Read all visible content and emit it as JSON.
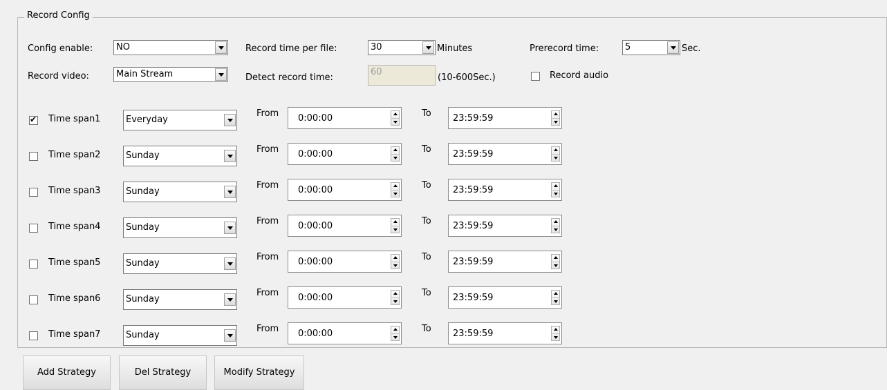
{
  "group_title": "Record Config",
  "config_enable": {
    "label": "Config enable:",
    "value": "NO"
  },
  "record_time_per_file": {
    "label": "Record time per file:",
    "value": "30",
    "unit": "Minutes"
  },
  "prerecord_time": {
    "label": "Prerecord time:",
    "value": "5",
    "unit": "Sec."
  },
  "record_video": {
    "label": "Record video:",
    "value": "Main Stream"
  },
  "detect_record_time": {
    "label": "Detect record time:",
    "value": "60",
    "hint": "(10-600Sec.)"
  },
  "record_audio": {
    "label": "Record audio",
    "checked": false
  },
  "time_spans": [
    {
      "label": "Time span1",
      "checked": true,
      "day": "Everyday",
      "from_label": "From",
      "from": "0:00:00",
      "to_label": "To",
      "to": "23:59:59"
    },
    {
      "label": "Time span2",
      "checked": false,
      "day": "Sunday",
      "from_label": "From",
      "from": "0:00:00",
      "to_label": "To",
      "to": "23:59:59"
    },
    {
      "label": "Time span3",
      "checked": false,
      "day": "Sunday",
      "from_label": "From",
      "from": "0:00:00",
      "to_label": "To",
      "to": "23:59:59"
    },
    {
      "label": "Time span4",
      "checked": false,
      "day": "Sunday",
      "from_label": "From",
      "from": "0:00:00",
      "to_label": "To",
      "to": "23:59:59"
    },
    {
      "label": "Time span5",
      "checked": false,
      "day": "Sunday",
      "from_label": "From",
      "from": "0:00:00",
      "to_label": "To",
      "to": "23:59:59"
    },
    {
      "label": "Time span6",
      "checked": false,
      "day": "Sunday",
      "from_label": "From",
      "from": "0:00:00",
      "to_label": "To",
      "to": "23:59:59"
    },
    {
      "label": "Time span7",
      "checked": false,
      "day": "Sunday",
      "from_label": "From",
      "from": "0:00:00",
      "to_label": "To",
      "to": "23:59:59"
    }
  ],
  "buttons": {
    "add": "Add Strategy",
    "del": "Del Strategy",
    "modify": "Modify Strategy"
  }
}
